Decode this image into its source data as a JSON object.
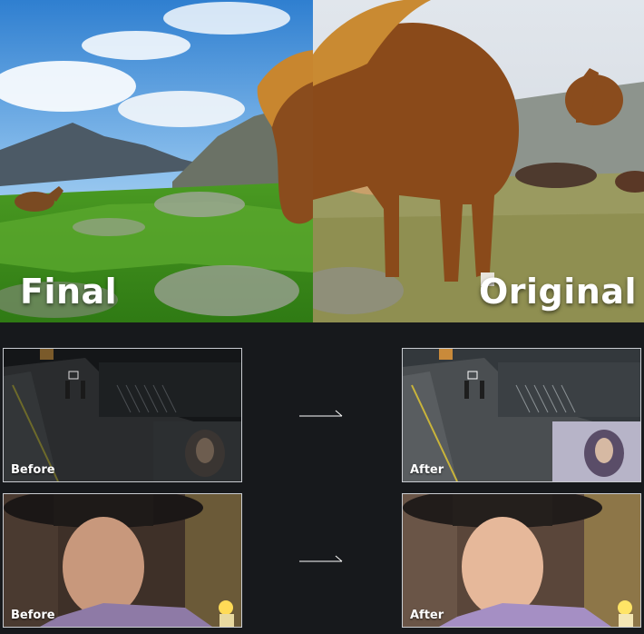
{
  "hero": {
    "left_label": "Final",
    "right_label": "Original"
  },
  "comparisons": [
    {
      "before_label": "Before",
      "after_label": "After",
      "scene": "night-street-cctv"
    },
    {
      "before_label": "Before",
      "after_label": "After",
      "scene": "portrait-with-hat"
    }
  ],
  "colors": {
    "background": "#17191c",
    "frame_border": "#c9ccd1",
    "label_text": "#ffffff",
    "arrow": "#ffffff"
  }
}
